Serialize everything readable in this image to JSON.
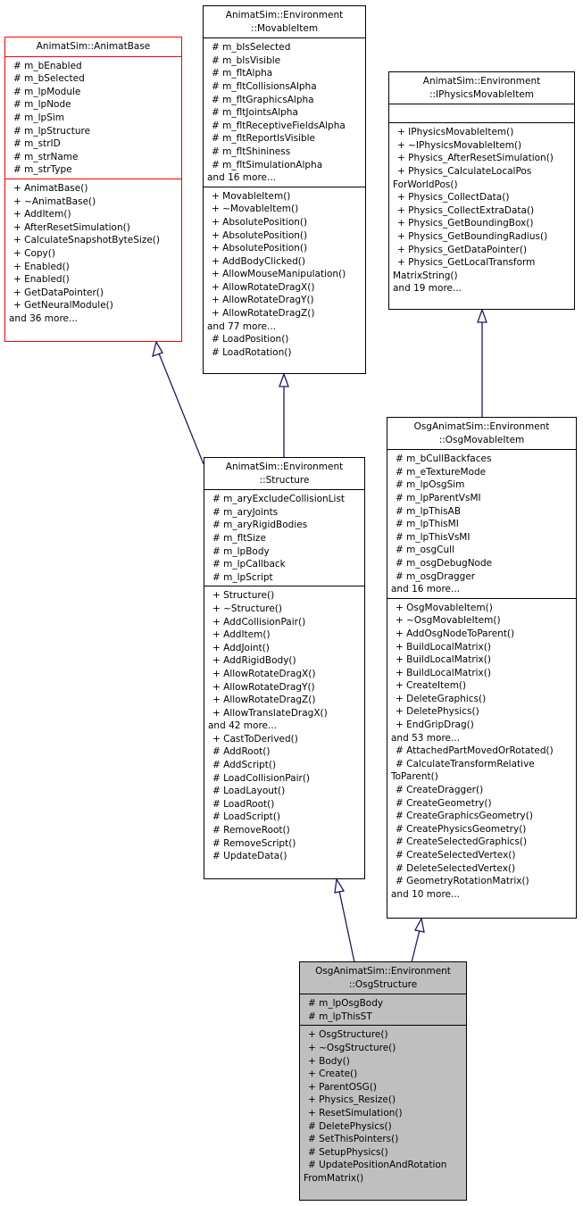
{
  "diagram": {
    "type": "uml-class-inheritance",
    "classes": {
      "animatBase": {
        "title": "AnimatSim::AnimatBase",
        "attributes": [
          "# m_bEnabled",
          "# m_bSelected",
          "# m_lpModule",
          "# m_lpNode",
          "# m_lpSim",
          "# m_lpStructure",
          "# m_strID",
          "# m_strName",
          "# m_strType"
        ],
        "methods": [
          "+ AnimatBase()",
          "+ ~AnimatBase()",
          "+ AddItem()",
          "+ AfterResetSimulation()",
          "+ CalculateSnapshotByteSize()",
          "+ Copy()",
          "+ Enabled()",
          "+ Enabled()",
          "+ GetDataPointer()",
          "+ GetNeuralModule()",
          "and 36 more..."
        ]
      },
      "movableItem": {
        "title": "AnimatSim::Environment\n::MovableItem",
        "attributes": [
          "# m_bIsSelected",
          "# m_bIsVisible",
          "# m_fltAlpha",
          "# m_fltCollisionsAlpha",
          "# m_fltGraphicsAlpha",
          "# m_fltJointsAlpha",
          "# m_fltReceptiveFieldsAlpha",
          "# m_fltReportIsVisible",
          "# m_fltShininess",
          "# m_fltSimulationAlpha",
          "and 16 more..."
        ],
        "methods": [
          "+ MovableItem()",
          "+ ~MovableItem()",
          "+ AbsolutePosition()",
          "+ AbsolutePosition()",
          "+ AbsolutePosition()",
          "+ AddBodyClicked()",
          "+ AllowMouseManipulation()",
          "+ AllowRotateDragX()",
          "+ AllowRotateDragY()",
          "+ AllowRotateDragZ()",
          "and 77 more...",
          "# LoadPosition()",
          "# LoadRotation()"
        ]
      },
      "iPhysicsMovableItem": {
        "title": "AnimatSim::Environment\n::IPhysicsMovableItem",
        "attributes": [],
        "methods": [
          "+ IPhysicsMovableItem()",
          "+ ~IPhysicsMovableItem()",
          "+ Physics_AfterResetSimulation()",
          "+ Physics_CalculateLocalPos",
          "ForWorldPos()",
          "+ Physics_CollectData()",
          "+ Physics_CollectExtraData()",
          "+ Physics_GetBoundingBox()",
          "+ Physics_GetBoundingRadius()",
          "+ Physics_GetDataPointer()",
          "+ Physics_GetLocalTransform",
          "MatrixString()",
          "and 19 more..."
        ]
      },
      "structure": {
        "title": "AnimatSim::Environment\n::Structure",
        "attributes": [
          "# m_aryExcludeCollisionList",
          "# m_aryJoints",
          "# m_aryRigidBodies",
          "# m_fltSize",
          "# m_lpBody",
          "# m_lpCallback",
          "# m_lpScript"
        ],
        "methods": [
          "+ Structure()",
          "+ ~Structure()",
          "+ AddCollisionPair()",
          "+ AddItem()",
          "+ AddJoint()",
          "+ AddRigidBody()",
          "+ AllowRotateDragX()",
          "+ AllowRotateDragY()",
          "+ AllowRotateDragZ()",
          "+ AllowTranslateDragX()",
          "and 42 more...",
          "+ CastToDerived()",
          "# AddRoot()",
          "# AddScript()",
          "# LoadCollisionPair()",
          "# LoadLayout()",
          "# LoadRoot()",
          "# LoadScript()",
          "# RemoveRoot()",
          "# RemoveScript()",
          "# UpdateData()"
        ]
      },
      "osgMovableItem": {
        "title": "OsgAnimatSim::Environment\n::OsgMovableItem",
        "attributes": [
          "# m_bCullBackfaces",
          "# m_eTextureMode",
          "# m_lpOsgSim",
          "# m_lpParentVsMI",
          "# m_lpThisAB",
          "# m_lpThisMI",
          "# m_lpThisVsMI",
          "# m_osgCull",
          "# m_osgDebugNode",
          "# m_osgDragger",
          "and 16 more..."
        ],
        "methods": [
          "+ OsgMovableItem()",
          "+ ~OsgMovableItem()",
          "+ AddOsgNodeToParent()",
          "+ BuildLocalMatrix()",
          "+ BuildLocalMatrix()",
          "+ BuildLocalMatrix()",
          "+ CreateItem()",
          "+ DeleteGraphics()",
          "+ DeletePhysics()",
          "+ EndGripDrag()",
          "and 53 more...",
          "# AttachedPartMovedOrRotated()",
          "# CalculateTransformRelative",
          "ToParent()",
          "# CreateDragger()",
          "# CreateGeometry()",
          "# CreateGraphicsGeometry()",
          "# CreatePhysicsGeometry()",
          "# CreateSelectedGraphics()",
          "# CreateSelectedVertex()",
          "# DeleteSelectedVertex()",
          "# GeometryRotationMatrix()",
          "and 10 more..."
        ]
      },
      "osgStructure": {
        "title": "OsgAnimatSim::Environment\n::OsgStructure",
        "attributes": [
          "# m_lpOsgBody",
          "# m_lpThisST"
        ],
        "methods": [
          "+ OsgStructure()",
          "+ ~OsgStructure()",
          "+ Body()",
          "+ Create()",
          "+ ParentOSG()",
          "+ Physics_Resize()",
          "+ ResetSimulation()",
          "# DeletePhysics()",
          "# SetThisPointers()",
          "# SetupPhysics()",
          "# UpdatePositionAndRotation",
          "FromMatrix()"
        ]
      }
    },
    "inheritance": [
      {
        "from": "structure",
        "to": "animatBase"
      },
      {
        "from": "structure",
        "to": "movableItem"
      },
      {
        "from": "osgMovableItem",
        "to": "iPhysicsMovableItem"
      },
      {
        "from": "osgStructure",
        "to": "structure"
      },
      {
        "from": "osgStructure",
        "to": "osgMovableItem"
      }
    ],
    "colors": {
      "edge": "#191970",
      "base_border": "#ff0000",
      "focus_fill": "#bfbfbf",
      "border": "#000000"
    }
  }
}
